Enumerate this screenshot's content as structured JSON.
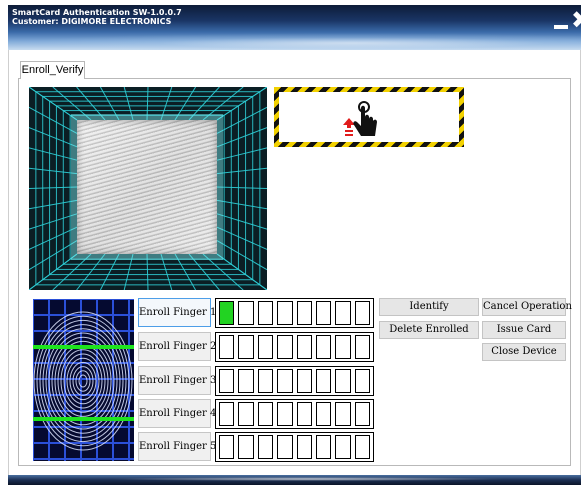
{
  "window": {
    "title": "SmartCard Authentication SW-1.0.0.7",
    "customer": "Customer: DIGIMORE ELECTRONICS",
    "minimize_icon": "minimize-icon",
    "close_icon": "close-icon",
    "close_glyph": "✖"
  },
  "tabs": [
    {
      "label": "Enroll_Verify",
      "active": true
    }
  ],
  "scanner": {
    "grid_color": "#2fd0d8",
    "instruction_icons": [
      "arrow-up-icon",
      "hand-pointer-icon"
    ]
  },
  "enroll": {
    "buttons": [
      {
        "label": "Enroll Finger 1",
        "active": true
      },
      {
        "label": "Enroll Finger 2",
        "active": false
      },
      {
        "label": "Enroll Finger 3",
        "active": false
      },
      {
        "label": "Enroll Finger 4",
        "active": false
      },
      {
        "label": "Enroll Finger 5",
        "active": false
      }
    ],
    "progress_steps": 8,
    "progress": [
      1,
      0,
      0,
      0,
      0
    ],
    "fill_color": "#22d322"
  },
  "actions": {
    "identify": "Identify",
    "cancel": "Cancel Operation",
    "delete": "Delete Enrolled",
    "issue_card": "Issue Card",
    "close_device": "Close Device"
  }
}
